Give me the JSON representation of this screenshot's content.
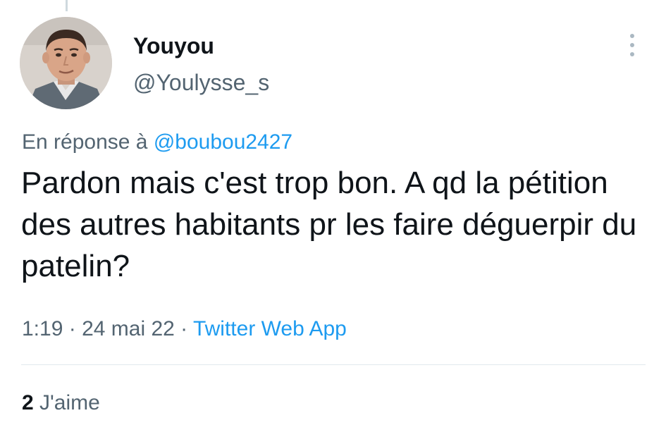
{
  "author": {
    "display_name": "Youyou",
    "handle": "@Youlysse_s",
    "avatar_icon": "avatar-photo"
  },
  "reply": {
    "prefix": "En réponse à",
    "mention": "@boubou2427"
  },
  "tweet": {
    "text": "Pardon mais c'est trop bon. A qd la pétition des autres habitants pr les faire déguerpir du patelin?"
  },
  "meta": {
    "time": "1:19",
    "separator": "·",
    "date": "24 mai 22",
    "source": "Twitter Web App"
  },
  "stats": {
    "likes_count": "2",
    "likes_label": "J'aime"
  },
  "colors": {
    "link": "#1d9bf0",
    "secondary_text": "#536471",
    "primary_text": "#0f1419"
  }
}
